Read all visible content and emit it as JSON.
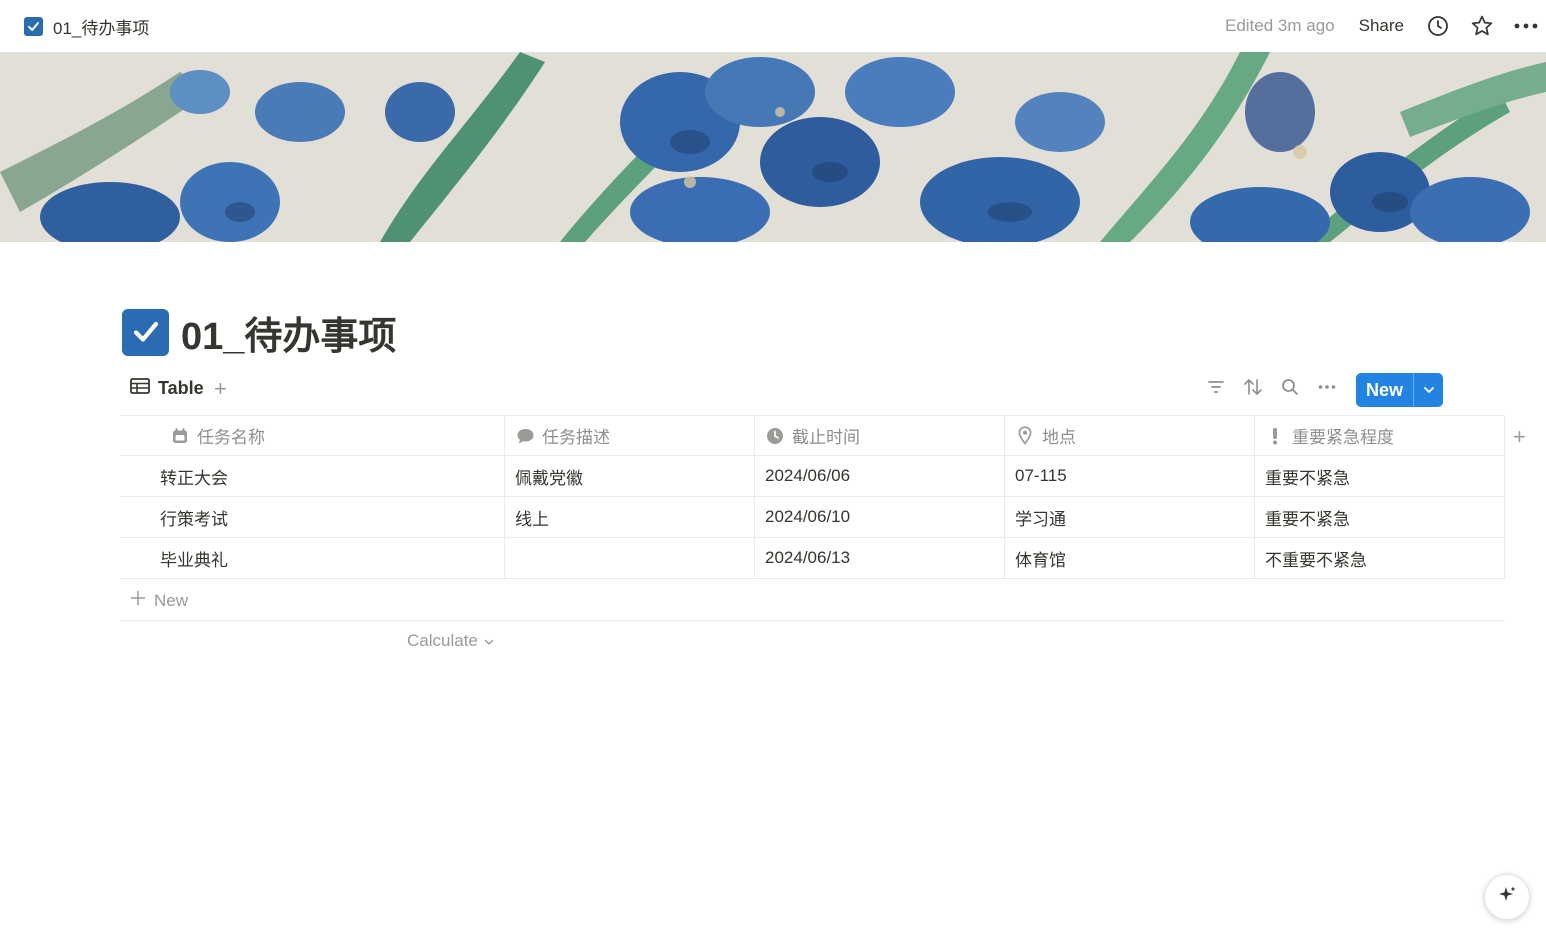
{
  "topbar": {
    "breadcrumb_title": "01_待办事项",
    "edited": "Edited 3m ago",
    "share": "Share"
  },
  "icons": {
    "breadcrumb": "checkbox-icon",
    "history": "clock-icon",
    "favorite": "star-icon",
    "more": "more-horizontal-icon"
  },
  "page": {
    "title": "01_待办事项"
  },
  "view": {
    "tab_label": "Table",
    "new_button": "New"
  },
  "table": {
    "columns": [
      {
        "label": "任务名称",
        "icon": "calendar-icon"
      },
      {
        "label": "任务描述",
        "icon": "speech-bubble-icon"
      },
      {
        "label": "截止时间",
        "icon": "clock-icon"
      },
      {
        "label": "地点",
        "icon": "location-pin-icon"
      },
      {
        "label": "重要紧急程度",
        "icon": "exclamation-icon"
      }
    ],
    "rows": [
      [
        "转正大会",
        "佩戴党徽",
        "2024/06/06",
        "07-115",
        "重要不紧急"
      ],
      [
        "行策考试",
        "线上",
        "2024/06/10",
        "学习通",
        "重要不紧急"
      ],
      [
        "毕业典礼",
        "",
        "2024/06/13",
        "体育馆",
        "不重要不紧急"
      ]
    ],
    "new_row": "New",
    "calculate": "Calculate"
  },
  "colors": {
    "accent": "#2383e2",
    "checkbox": "#2a6bb1",
    "text": "#37352f",
    "muted": "#9b9a97",
    "border": "#ebebea"
  }
}
